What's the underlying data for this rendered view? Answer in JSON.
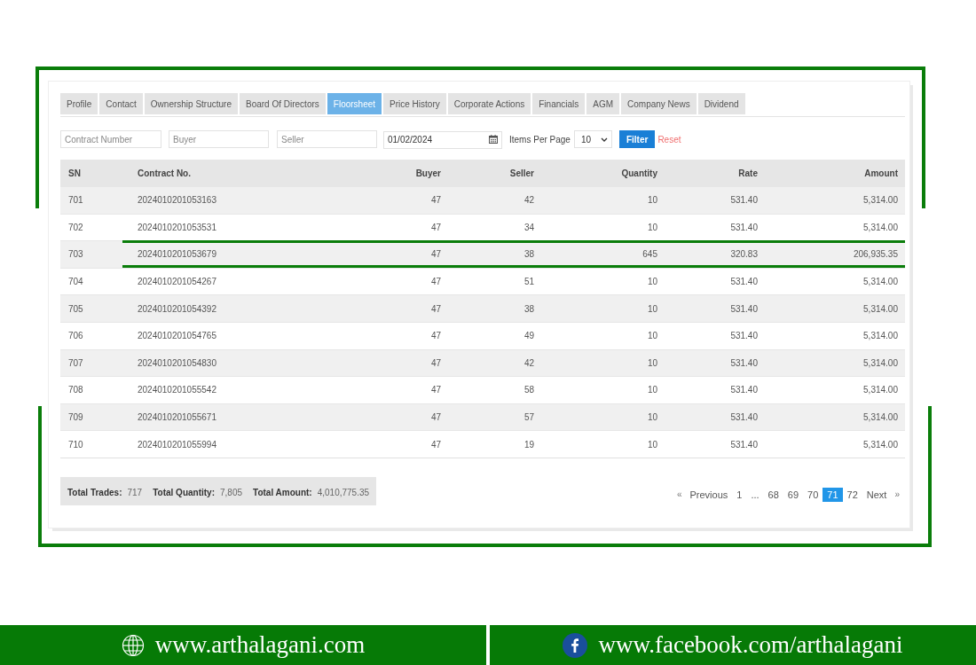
{
  "tabs": [
    {
      "label": "Profile",
      "selected": false
    },
    {
      "label": "Contact",
      "selected": false
    },
    {
      "label": "Ownership Structure",
      "selected": false
    },
    {
      "label": "Board Of Directors",
      "selected": false
    },
    {
      "label": "Floorsheet",
      "selected": true
    },
    {
      "label": "Price History",
      "selected": false
    },
    {
      "label": "Corporate Actions",
      "selected": false
    },
    {
      "label": "Financials",
      "selected": false
    },
    {
      "label": "AGM",
      "selected": false
    },
    {
      "label": "Company News",
      "selected": false
    },
    {
      "label": "Dividend",
      "selected": false
    }
  ],
  "filters": {
    "contract_number": {
      "placeholder": "Contract Number"
    },
    "buyer": {
      "placeholder": "Buyer"
    },
    "seller": {
      "placeholder": "Seller"
    },
    "date": {
      "value": "01/02/2024"
    },
    "items_per_page": {
      "label": "Items Per Page",
      "value": "10"
    },
    "filter_button": "Filter",
    "reset_link": "Reset"
  },
  "table": {
    "columns": [
      "SN",
      "Contract No.",
      "Buyer",
      "Seller",
      "Quantity",
      "Rate",
      "Amount"
    ],
    "rows": [
      {
        "cells": [
          "701",
          "2024010201053163",
          "47",
          "42",
          "10",
          "531.40",
          "5,314.00"
        ],
        "highlighted": false
      },
      {
        "cells": [
          "702",
          "2024010201053531",
          "47",
          "34",
          "10",
          "531.40",
          "5,314.00"
        ],
        "highlighted": false
      },
      {
        "cells": [
          "703",
          "2024010201053679",
          "47",
          "38",
          "645",
          "320.83",
          "206,935.35"
        ],
        "highlighted": true
      },
      {
        "cells": [
          "704",
          "2024010201054267",
          "47",
          "51",
          "10",
          "531.40",
          "5,314.00"
        ],
        "highlighted": false
      },
      {
        "cells": [
          "705",
          "2024010201054392",
          "47",
          "38",
          "10",
          "531.40",
          "5,314.00"
        ],
        "highlighted": false
      },
      {
        "cells": [
          "706",
          "2024010201054765",
          "47",
          "49",
          "10",
          "531.40",
          "5,314.00"
        ],
        "highlighted": false
      },
      {
        "cells": [
          "707",
          "2024010201054830",
          "47",
          "42",
          "10",
          "531.40",
          "5,314.00"
        ],
        "highlighted": false
      },
      {
        "cells": [
          "708",
          "2024010201055542",
          "47",
          "58",
          "10",
          "531.40",
          "5,314.00"
        ],
        "highlighted": false
      },
      {
        "cells": [
          "709",
          "2024010201055671",
          "47",
          "57",
          "10",
          "531.40",
          "5,314.00"
        ],
        "highlighted": false
      },
      {
        "cells": [
          "710",
          "2024010201055994",
          "47",
          "19",
          "10",
          "531.40",
          "5,314.00"
        ],
        "highlighted": false
      }
    ]
  },
  "totals": [
    {
      "label": "Total Trades:",
      "value": "717"
    },
    {
      "label": "Total Quantity:",
      "value": "7,805"
    },
    {
      "label": "Total Amount:",
      "value": "4,010,775.35"
    }
  ],
  "pagination": {
    "previous_arrow": "«",
    "previous": "Previous",
    "pages": [
      {
        "label": "1",
        "selected": false
      },
      {
        "label": "...",
        "selected": false
      },
      {
        "label": "68",
        "selected": false
      },
      {
        "label": "69",
        "selected": false
      },
      {
        "label": "70",
        "selected": false
      },
      {
        "label": "71",
        "selected": true
      },
      {
        "label": "72",
        "selected": false
      }
    ],
    "next": "Next",
    "next_arrow": "»"
  },
  "footer_banner": {
    "website": "www.arthalagani.com",
    "facebook": "www.facebook.com/arthalagani"
  }
}
